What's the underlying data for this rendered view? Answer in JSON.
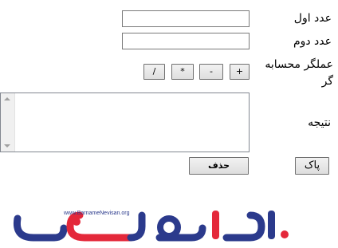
{
  "form": {
    "first_number_label": "عدد اول",
    "second_number_label": "عدد دوم",
    "operator_label": "عملگر محسابه گر",
    "result_label": "نتیجه",
    "first_number_value": "",
    "second_number_value": "",
    "result_value": ""
  },
  "operators": {
    "plus": "+",
    "minus": "-",
    "multiply": "*",
    "divide": "/"
  },
  "buttons": {
    "clear_label": "پاک",
    "delete_label": "حذف"
  },
  "logo": {
    "url_text": "www.BarnameNevisan.org",
    "brand_name": "برنامه نویسان"
  },
  "colors": {
    "logo_dark": "#2b3a8c",
    "logo_accent": "#e4283a"
  }
}
